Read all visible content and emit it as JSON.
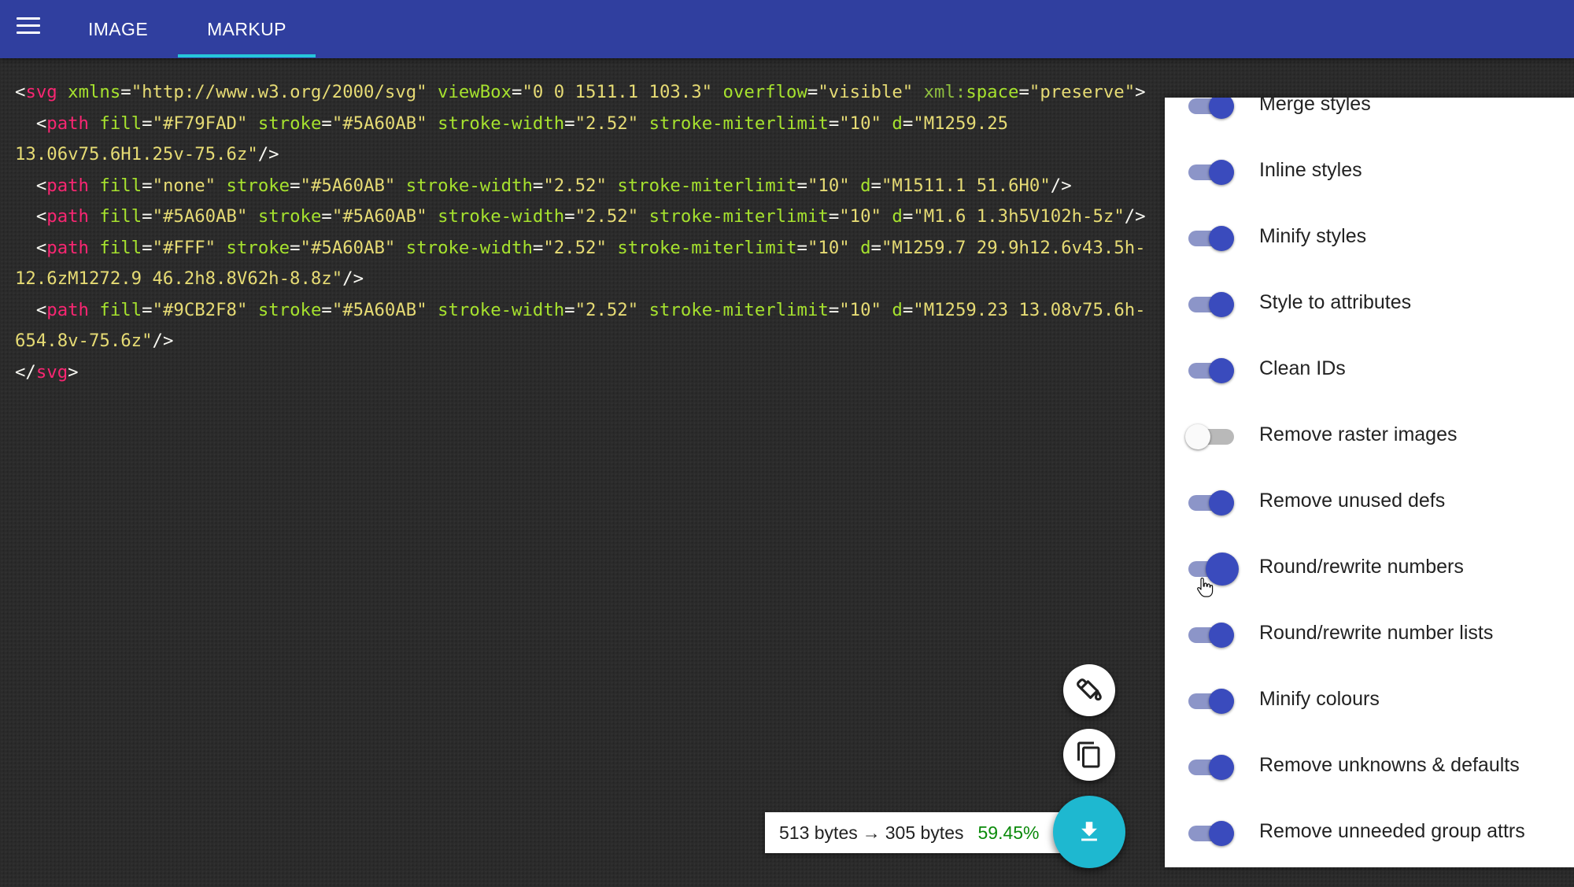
{
  "header": {
    "menu_icon": "hamburger-menu-icon",
    "tabs": [
      {
        "label": "IMAGE",
        "active": false
      },
      {
        "label": "MARKUP",
        "active": true
      }
    ],
    "colors": {
      "app_bar": "#303f9f",
      "active_tab_indicator": "#26c6da"
    }
  },
  "code": {
    "lines": [
      [
        [
          "pun",
          "<"
        ],
        [
          "tag",
          "svg"
        ],
        [
          "pun",
          " "
        ],
        [
          "attr",
          "xmlns"
        ],
        [
          "pun",
          "="
        ],
        [
          "str",
          "\"http://www.w3.org/2000/svg\""
        ],
        [
          "pun",
          " "
        ],
        [
          "attr",
          "viewBox"
        ],
        [
          "pun",
          "="
        ],
        [
          "str",
          "\"0 0 1511.1 103.3\""
        ],
        [
          "pun",
          " "
        ],
        [
          "attr",
          "overflow"
        ],
        [
          "pun",
          "="
        ],
        [
          "str",
          "\"visible\""
        ],
        [
          "pun",
          " "
        ],
        [
          "ns",
          "xml:"
        ],
        [
          "attr",
          "space"
        ],
        [
          "pun",
          "="
        ],
        [
          "str",
          "\"preserve\""
        ],
        [
          "pun",
          ">"
        ]
      ],
      [
        [
          "pun",
          "  <"
        ],
        [
          "tag",
          "path"
        ],
        [
          "pun",
          " "
        ],
        [
          "attr",
          "fill"
        ],
        [
          "pun",
          "="
        ],
        [
          "str",
          "\"#F79FAD\""
        ],
        [
          "pun",
          " "
        ],
        [
          "attr",
          "stroke"
        ],
        [
          "pun",
          "="
        ],
        [
          "str",
          "\"#5A60AB\""
        ],
        [
          "pun",
          " "
        ],
        [
          "attr",
          "stroke-width"
        ],
        [
          "pun",
          "="
        ],
        [
          "str",
          "\"2.52\""
        ],
        [
          "pun",
          " "
        ],
        [
          "attr",
          "stroke-miterlimit"
        ],
        [
          "pun",
          "="
        ],
        [
          "str",
          "\"10\""
        ],
        [
          "pun",
          " "
        ],
        [
          "attr",
          "d"
        ],
        [
          "pun",
          "="
        ],
        [
          "str",
          "\"M1259.25"
        ]
      ],
      [
        [
          "str",
          "13.06v75.6H1.25v-75.6z\""
        ],
        [
          "pun",
          "/>"
        ]
      ],
      [
        [
          "pun",
          "  <"
        ],
        [
          "tag",
          "path"
        ],
        [
          "pun",
          " "
        ],
        [
          "attr",
          "fill"
        ],
        [
          "pun",
          "="
        ],
        [
          "str",
          "\"none\""
        ],
        [
          "pun",
          " "
        ],
        [
          "attr",
          "stroke"
        ],
        [
          "pun",
          "="
        ],
        [
          "str",
          "\"#5A60AB\""
        ],
        [
          "pun",
          " "
        ],
        [
          "attr",
          "stroke-width"
        ],
        [
          "pun",
          "="
        ],
        [
          "str",
          "\"2.52\""
        ],
        [
          "pun",
          " "
        ],
        [
          "attr",
          "stroke-miterlimit"
        ],
        [
          "pun",
          "="
        ],
        [
          "str",
          "\"10\""
        ],
        [
          "pun",
          " "
        ],
        [
          "attr",
          "d"
        ],
        [
          "pun",
          "="
        ],
        [
          "str",
          "\"M1511.1 51.6H0\""
        ],
        [
          "pun",
          "/>"
        ]
      ],
      [
        [
          "pun",
          "  <"
        ],
        [
          "tag",
          "path"
        ],
        [
          "pun",
          " "
        ],
        [
          "attr",
          "fill"
        ],
        [
          "pun",
          "="
        ],
        [
          "str",
          "\"#5A60AB\""
        ],
        [
          "pun",
          " "
        ],
        [
          "attr",
          "stroke"
        ],
        [
          "pun",
          "="
        ],
        [
          "str",
          "\"#5A60AB\""
        ],
        [
          "pun",
          " "
        ],
        [
          "attr",
          "stroke-width"
        ],
        [
          "pun",
          "="
        ],
        [
          "str",
          "\"2.52\""
        ],
        [
          "pun",
          " "
        ],
        [
          "attr",
          "stroke-miterlimit"
        ],
        [
          "pun",
          "="
        ],
        [
          "str",
          "\"10\""
        ],
        [
          "pun",
          " "
        ],
        [
          "attr",
          "d"
        ],
        [
          "pun",
          "="
        ],
        [
          "str",
          "\"M1.6 1.3h5V102h-5z\""
        ],
        [
          "pun",
          "/>"
        ]
      ],
      [
        [
          "pun",
          "  <"
        ],
        [
          "tag",
          "path"
        ],
        [
          "pun",
          " "
        ],
        [
          "attr",
          "fill"
        ],
        [
          "pun",
          "="
        ],
        [
          "str",
          "\"#FFF\""
        ],
        [
          "pun",
          " "
        ],
        [
          "attr",
          "stroke"
        ],
        [
          "pun",
          "="
        ],
        [
          "str",
          "\"#5A60AB\""
        ],
        [
          "pun",
          " "
        ],
        [
          "attr",
          "stroke-width"
        ],
        [
          "pun",
          "="
        ],
        [
          "str",
          "\"2.52\""
        ],
        [
          "pun",
          " "
        ],
        [
          "attr",
          "stroke-miterlimit"
        ],
        [
          "pun",
          "="
        ],
        [
          "str",
          "\"10\""
        ],
        [
          "pun",
          " "
        ],
        [
          "attr",
          "d"
        ],
        [
          "pun",
          "="
        ],
        [
          "str",
          "\"M1259.7 29.9h12.6v43.5h-"
        ]
      ],
      [
        [
          "str",
          "12.6zM1272.9 46.2h8.8V62h-8.8z\""
        ],
        [
          "pun",
          "/>"
        ]
      ],
      [
        [
          "pun",
          "  <"
        ],
        [
          "tag",
          "path"
        ],
        [
          "pun",
          " "
        ],
        [
          "attr",
          "fill"
        ],
        [
          "pun",
          "="
        ],
        [
          "str",
          "\"#9CB2F8\""
        ],
        [
          "pun",
          " "
        ],
        [
          "attr",
          "stroke"
        ],
        [
          "pun",
          "="
        ],
        [
          "str",
          "\"#5A60AB\""
        ],
        [
          "pun",
          " "
        ],
        [
          "attr",
          "stroke-width"
        ],
        [
          "pun",
          "="
        ],
        [
          "str",
          "\"2.52\""
        ],
        [
          "pun",
          " "
        ],
        [
          "attr",
          "stroke-miterlimit"
        ],
        [
          "pun",
          "="
        ],
        [
          "str",
          "\"10\""
        ],
        [
          "pun",
          " "
        ],
        [
          "attr",
          "d"
        ],
        [
          "pun",
          "="
        ],
        [
          "str",
          "\"M1259.23 13.08v75.6h-"
        ]
      ],
      [
        [
          "str",
          "654.8v-75.6z\""
        ],
        [
          "pun",
          "/>"
        ]
      ],
      [
        [
          "pun",
          "</"
        ],
        [
          "tag",
          "svg"
        ],
        [
          "pun",
          ">"
        ]
      ]
    ],
    "colors": {
      "tag": "#f92672",
      "attr": "#a6e22e",
      "ns": "#8fbf3f",
      "str": "#e6db74",
      "pun": "#f8f8f2"
    }
  },
  "settings": {
    "options": [
      {
        "label": "Merge styles",
        "on": true
      },
      {
        "label": "Inline styles",
        "on": true
      },
      {
        "label": "Minify styles",
        "on": true
      },
      {
        "label": "Style to attributes",
        "on": true
      },
      {
        "label": "Clean IDs",
        "on": true
      },
      {
        "label": "Remove raster images",
        "on": false
      },
      {
        "label": "Remove unused defs",
        "on": true
      },
      {
        "label": "Round/rewrite numbers",
        "on": true,
        "pressed": true
      },
      {
        "label": "Round/rewrite number lists",
        "on": true
      },
      {
        "label": "Minify colours",
        "on": true
      },
      {
        "label": "Remove unknowns & defaults",
        "on": true
      },
      {
        "label": "Remove unneeded group attrs",
        "on": true
      }
    ],
    "colors": {
      "toggle_on": "#3a4bbd",
      "track_on": "#8c95c8",
      "toggle_off": "#fafafa",
      "track_off": "#b9b9b9"
    }
  },
  "actions": {
    "bake_icon": "paint-bucket-icon",
    "copy_icon": "copy-icon",
    "download_icon": "download-icon",
    "download_color": "#1eb8d0"
  },
  "results": {
    "original": "513 bytes",
    "arrow": "→",
    "optimized": "305 bytes",
    "saving": "59.45%",
    "saving_color": "#0a8a0a"
  }
}
